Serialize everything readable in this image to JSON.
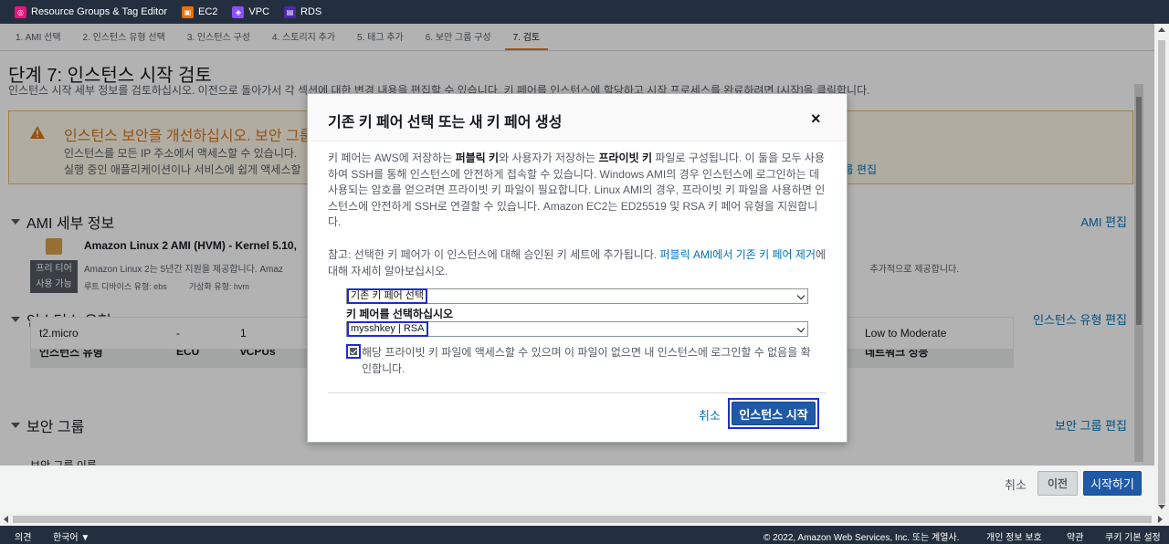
{
  "bookmarks": [
    {
      "label": "Resource Groups & Tag Editor",
      "color": "#e7157b",
      "glyph": "◎",
      "icon": "resource-groups-icon"
    },
    {
      "label": "EC2",
      "color": "#ed7100",
      "glyph": "▣",
      "icon": "ec2-icon"
    },
    {
      "label": "VPC",
      "color": "#8c4fff",
      "glyph": "◈",
      "icon": "vpc-icon"
    },
    {
      "label": "RDS",
      "color": "#4d27aa",
      "glyph": "▤",
      "icon": "rds-icon"
    }
  ],
  "steps": [
    "1. AMI 선택",
    "2. 인스턴스 유형 선택",
    "3. 인스턴스 구성",
    "4. 스토리지 추가",
    "5. 태그 추가",
    "6. 보안 그룹 구성",
    "7. 검토"
  ],
  "active_step": 6,
  "page": {
    "title": "단계 7: 인스턴스 시작 검토",
    "description": "인스턴스 시작 세부 정보를 검토하십시오. 이전으로 돌아가서 각 섹션에 대한 변경 내용을 편집할 수 있습니다. 키 페어를 인스턴스에 할당하고 시작 프로세스를 완료하려면 [시작]을 클릭합니다."
  },
  "warning": {
    "title": "인스턴스 보안을 개선하십시오. 보안 그룹",
    "line1": "인스턴스를 모든 IP 주소에서 액세스할 수 있습니다.",
    "line2": "실행 중인 애플리케이션이나 서비스에 쉽게 액세스할",
    "link": "룹 편집"
  },
  "sections": {
    "ami": {
      "title": "AMI 세부 정보",
      "edit": "AMI 편집"
    },
    "instance_type": {
      "title": "인스턴스 유형",
      "edit": "인스턴스 유형 편집"
    },
    "security_group": {
      "title": "보안 그룹",
      "edit": "보안 그룹 편집",
      "sub": "보안 그룹 이름"
    }
  },
  "ami": {
    "name": "Amazon Linux 2 AMI (HVM) - Kernel 5.10,",
    "badge_line1": "프리 티어",
    "badge_line2": "사용 가능",
    "desc": "Amazon Linux 2는 5년간 지원을 제공합니다. Amaz",
    "desc_right": "추가적으로 제공합니다.",
    "root_device": "루트 디바이스 유형: ebs",
    "virt_type": "가상화 유형: hvm"
  },
  "instance_table": {
    "headers": [
      "인스턴스 유형",
      "ECU",
      "vCPUs",
      "네트워크 성능"
    ],
    "row": [
      "t2.micro",
      "-",
      "1",
      "Low to Moderate"
    ]
  },
  "modal": {
    "title": "기존 키 페어 선택 또는 새 키 페어 생성",
    "close": "×",
    "p1_a": "키 페어는 AWS에 저장하는 ",
    "p1_b": "퍼블릭 키",
    "p1_c": "와 사용자가 저장하는 ",
    "p1_d": "프라이빗 키",
    "p1_e": " 파일로 구성됩니다. 이 둘을 모두 사용하여 SSH를 통해 인스턴스에 안전하게 접속할 수 있습니다. Windows AMI의 경우 인스턴스에 로그인하는 데 사용되는 암호를 얻으려면 프라이빗 키 파일이 필요합니다. Linux AMI의 경우, 프라이빗 키 파일을 사용하면 인스턴스에 안전하게 SSH로 연결할 수 있습니다. Amazon EC2는 ED25519 및 RSA 키 페어 유형을 지원합니다.",
    "p2_a": "참고: 선택한 키 페어가 이 인스턴스에 대해 승인된 키 세트에 추가됩니다. ",
    "p2_link": "퍼블릭 AMI에서 기존 키 페어 제거",
    "p2_b": "에 대해 자세히 알아보십시오.",
    "select_mode": "기존 키 페어 선택",
    "key_label": "키 페어를 선택하십시오",
    "key_value": "mysshkey | RSA",
    "ack": "해당 프라이빗 키 파일에 액세스할 수 있으며 이 파일이 없으면 내 인스턴스에 로그인할 수 없음을 확인합니다.",
    "ack_checked": true,
    "cancel": "취소",
    "launch": "인스턴스 시작"
  },
  "actions": {
    "cancel": "취소",
    "prev": "이전",
    "launch": "시작하기"
  },
  "footer": {
    "feedback": "의견",
    "language": "한국어 ▼",
    "copyright": "© 2022, Amazon Web Services, Inc. 또는 계열사.",
    "privacy": "개인 정보 보호",
    "terms": "약관",
    "cookies": "쿠키 기본 설정"
  }
}
